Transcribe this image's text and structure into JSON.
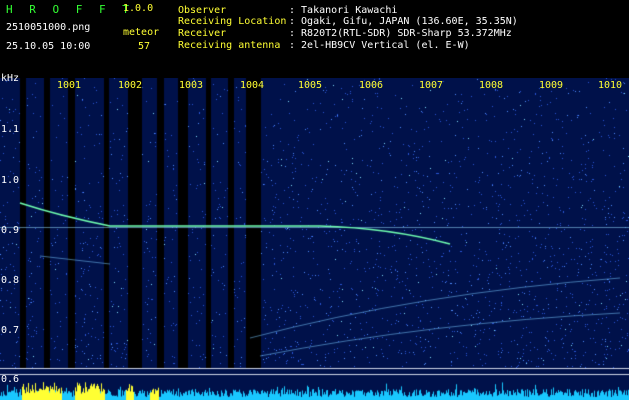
{
  "header": {
    "logo": "H R O F F T",
    "version": "1.0.0",
    "filename": "2510051000.png",
    "datetime": "25.10.05 10:00",
    "detector_label": "meteor",
    "detector_count": "57"
  },
  "info": [
    {
      "label": "Observer",
      "value": ": Takanori Kawachi"
    },
    {
      "label": "Receiving Location",
      "value": ": Ogaki, Gifu, JAPAN (136.60E, 35.35N)"
    },
    {
      "label": "Receiver",
      "value": ": R820T2(RTL-SDR) SDR-Sharp 53.372MHz"
    },
    {
      "label": "Receiving antenna",
      "value": ": 2el-HB9CV Vertical (el. E-W)"
    }
  ],
  "spectrogram": {
    "y_unit": "kHz",
    "y_ticks": [
      "1.1",
      "1.0",
      "0.9",
      "0.8",
      "0.7",
      "0.6"
    ],
    "x_ticks": [
      "1001",
      "1002",
      "1003",
      "1004",
      "1005",
      "1006",
      "1007",
      "1008",
      "1009",
      "1010"
    ],
    "colors": {
      "background": "#00114a",
      "noise": "#2a55d6",
      "signal": "#6fffb0",
      "tick": "#ffff33",
      "meter_bar": "#19c8ff",
      "meter_peak": "#ffff33"
    }
  }
}
